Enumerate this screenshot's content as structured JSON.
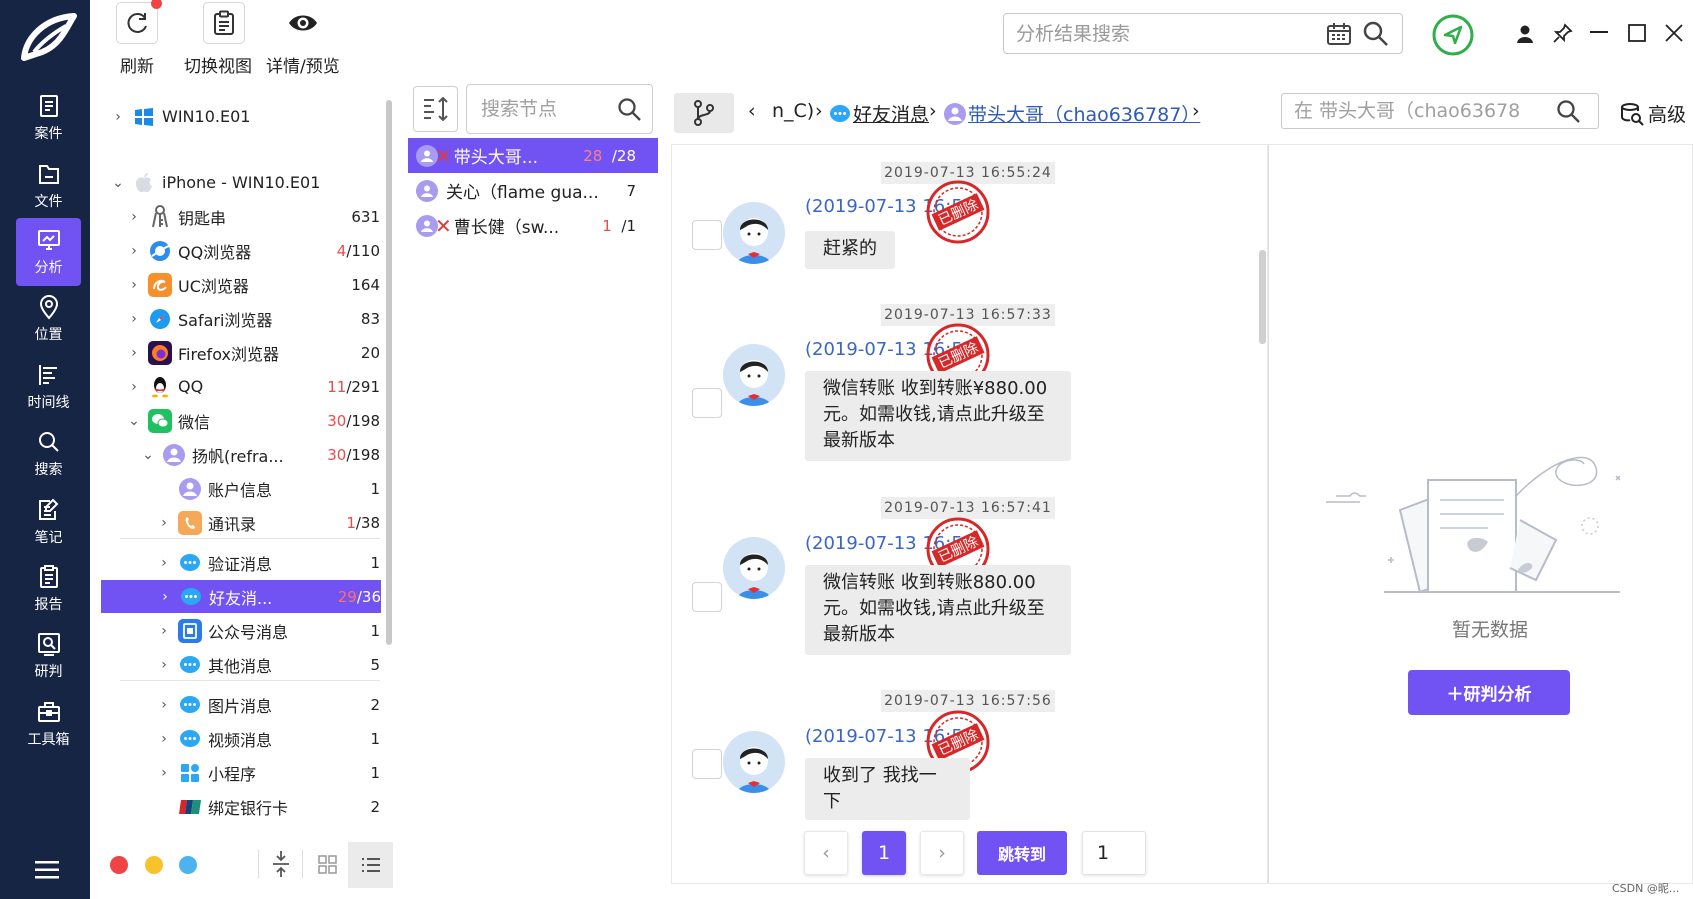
{
  "rail": {
    "items": [
      {
        "label": "案件",
        "icon": "case-icon"
      },
      {
        "label": "文件",
        "icon": "folder-icon"
      },
      {
        "label": "分析",
        "icon": "analysis-icon"
      },
      {
        "label": "位置",
        "icon": "location-icon"
      },
      {
        "label": "时间线",
        "icon": "timeline-icon"
      },
      {
        "label": "搜索",
        "icon": "search-icon"
      },
      {
        "label": "笔记",
        "icon": "note-icon"
      },
      {
        "label": "报告",
        "icon": "report-icon"
      },
      {
        "label": "研判",
        "icon": "research-icon"
      },
      {
        "label": "工具箱",
        "icon": "toolbox-icon"
      }
    ],
    "active_color": "#7152f2",
    "bg_color": "#172545"
  },
  "toolbar": {
    "refresh_label": "刷新",
    "switch_view_label": "切换视图",
    "detail_label": "详情/预览",
    "search_placeholder": "分析结果搜索"
  },
  "tree": {
    "rows": [
      {
        "label": "WIN10.E01",
        "icon": "windows-icon",
        "count_red": "",
        "count": ""
      },
      {
        "label": "iPhone - WIN10.E01",
        "icon": "apple-icon",
        "count_red": "",
        "count": ""
      },
      {
        "label": "钥匙串",
        "icon": "keychain-icon",
        "count_red": "",
        "count": "631"
      },
      {
        "label": "QQ浏览器",
        "icon": "qq-browser-icon",
        "count_red": "4",
        "count": "/110"
      },
      {
        "label": "UC浏览器",
        "icon": "uc-browser-icon",
        "count_red": "",
        "count": "164"
      },
      {
        "label": "Safari浏览器",
        "icon": "safari-icon",
        "count_red": "",
        "count": "83"
      },
      {
        "label": "Firefox浏览器",
        "icon": "firefox-icon",
        "count_red": "",
        "count": "20"
      },
      {
        "label": "QQ",
        "icon": "qq-icon",
        "count_red": "11",
        "count": "/291"
      },
      {
        "label": "微信",
        "icon": "wechat-icon",
        "count_red": "30",
        "count": "/198"
      },
      {
        "label": "扬帆(refra...",
        "icon": "user-icon",
        "count_red": "30",
        "count": "/198"
      },
      {
        "label": "账户信息",
        "icon": "user-icon",
        "count_red": "",
        "count": "1"
      },
      {
        "label": "通讯录",
        "icon": "contacts-icon",
        "count_red": "1",
        "count": "/38"
      },
      {
        "label": "验证消息",
        "icon": "message-icon",
        "count_red": "",
        "count": "1"
      },
      {
        "label": "好友消...",
        "icon": "message-icon",
        "count_red": "29",
        "count": "/36"
      },
      {
        "label": "公众号消息",
        "icon": "official-account-icon",
        "count_red": "",
        "count": "1"
      },
      {
        "label": "其他消息",
        "icon": "message-icon",
        "count_red": "",
        "count": "5"
      },
      {
        "label": "图片消息",
        "icon": "message-icon",
        "count_red": "",
        "count": "2"
      },
      {
        "label": "视频消息",
        "icon": "message-icon",
        "count_red": "",
        "count": "1"
      },
      {
        "label": "小程序",
        "icon": "mini-program-icon",
        "count_red": "",
        "count": "1"
      },
      {
        "label": "绑定银行卡",
        "icon": "bank-card-icon",
        "count_red": "",
        "count": "2"
      }
    ],
    "selected_label": "好友消..."
  },
  "nodes": {
    "search_placeholder": "搜索节点",
    "items": [
      {
        "label": "带头大哥...",
        "deleted": true,
        "count_red": "28",
        "count": "/28"
      },
      {
        "label": "关心（flame gua...",
        "deleted": false,
        "count_red": "",
        "count": "7"
      },
      {
        "label": "曹长健（sw...",
        "deleted": true,
        "count_red": "1",
        "count": "/1"
      }
    ]
  },
  "chat_header": {
    "crumb_prev": "n_C)",
    "crumb_mid": "好友消息",
    "crumb_current": "带头大哥（chao636787）",
    "search_placeholder": "在 带头大哥（chao63678",
    "advanced_label": "高级"
  },
  "messages": [
    {
      "time": "2019-07-13 16:55:24",
      "sender": "(2019-07-13 16:55:24)",
      "text": "赶紧的",
      "stamp": "已删除"
    },
    {
      "time": "2019-07-13 16:57:33",
      "sender": "(2019-07-13 16:57:33)",
      "text": "微信转账 收到转账¥880.00元。如需收钱,请点此升级至最新版本",
      "stamp": "已删除"
    },
    {
      "time": "2019-07-13 16:57:41",
      "sender": "(2019-07-13 16:57:41)",
      "text": "微信转账 收到转账880.00元。如需收钱,请点此升级至最新版本",
      "stamp": "已删除"
    },
    {
      "time": "2019-07-13 16:57:56",
      "sender": "(2019-07-13 16:57:56)",
      "text": "收到了 我找一下",
      "stamp": "已删除"
    }
  ],
  "pagination": {
    "prev": "‹",
    "current": "1",
    "next": "›",
    "jump_label": "跳转到",
    "jump_value": "1"
  },
  "right_panel": {
    "empty_text": "暂无数据",
    "add_button": "＋研判分析"
  },
  "watermark": "CSDN @昵...",
  "colors": {
    "accent": "#7152f2",
    "deleted_red": "#e03a3a",
    "link_blue": "#2d5ab8"
  }
}
